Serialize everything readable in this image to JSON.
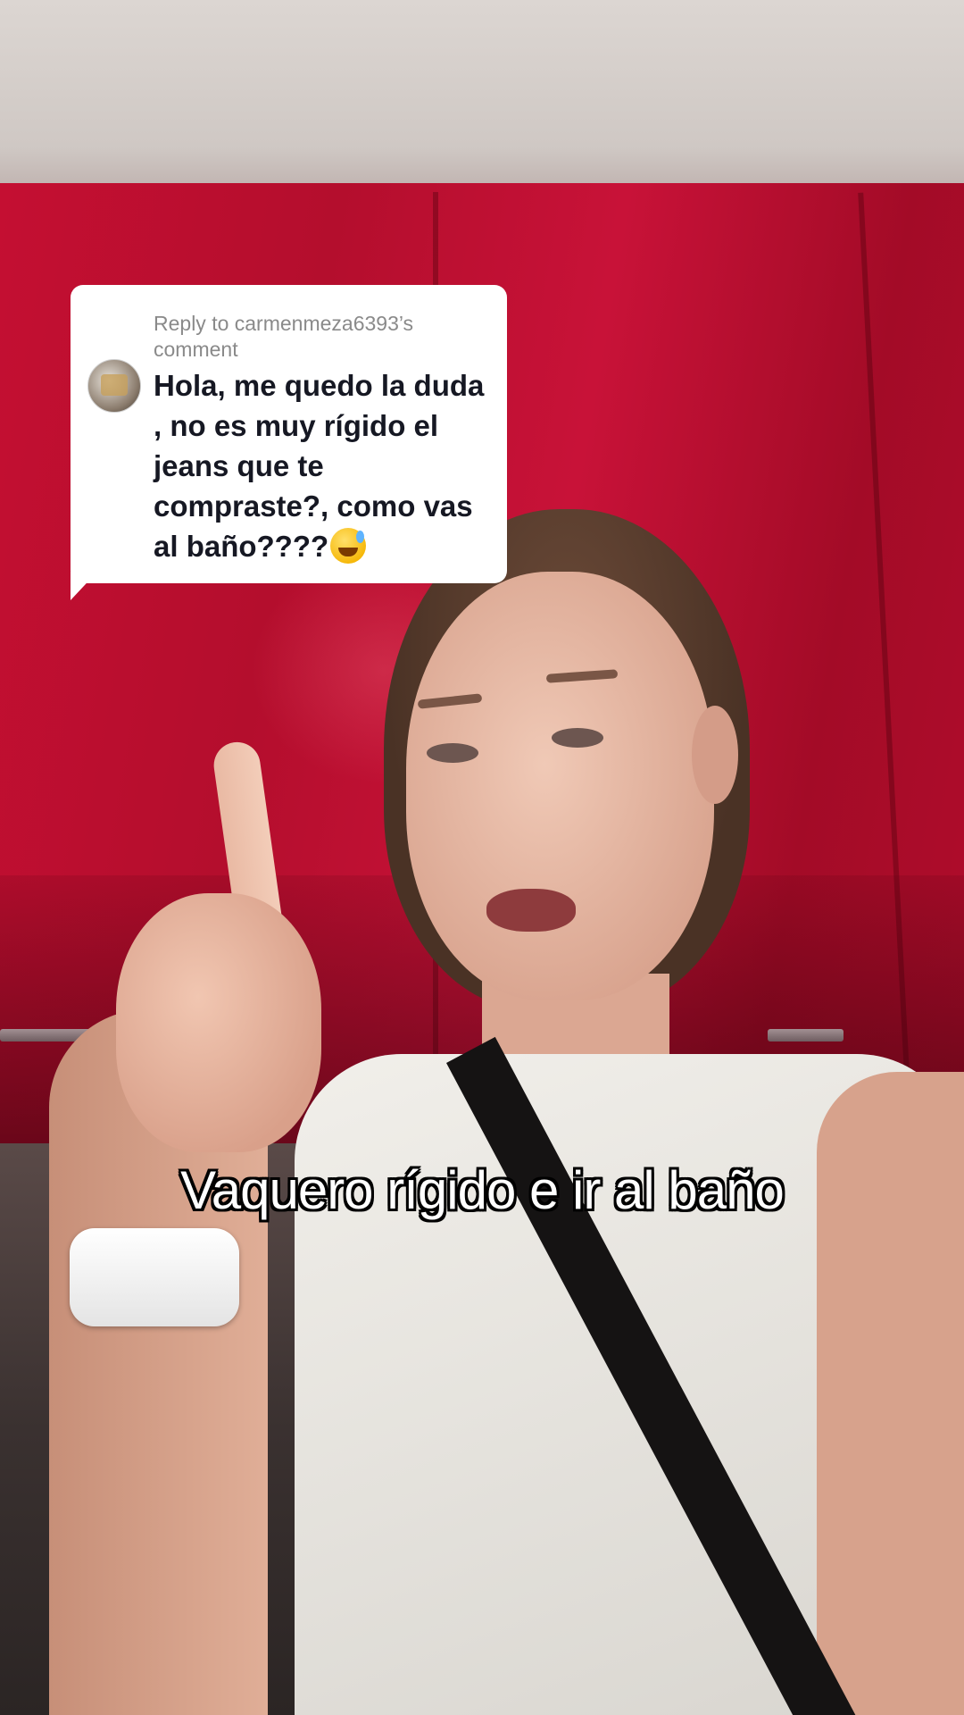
{
  "comment_reply": {
    "reply_label": "Reply to carmenmeza6393’s comment",
    "avatar": "commenter-avatar",
    "text": "Hola, me quedo la duda , no es muy rígido el jeans que te compraste?, como vas al baño????",
    "emoji": "grinning-face-with-sweat"
  },
  "caption": "Vaquero rígido e ir al baño",
  "colors": {
    "bubble_bg": "#ffffff",
    "comment_text": "#161823",
    "reply_label_text": "#8a8a8a",
    "cabinet_red": "#c40f32",
    "caption_text": "#ffffff",
    "caption_outline": "#000000"
  }
}
